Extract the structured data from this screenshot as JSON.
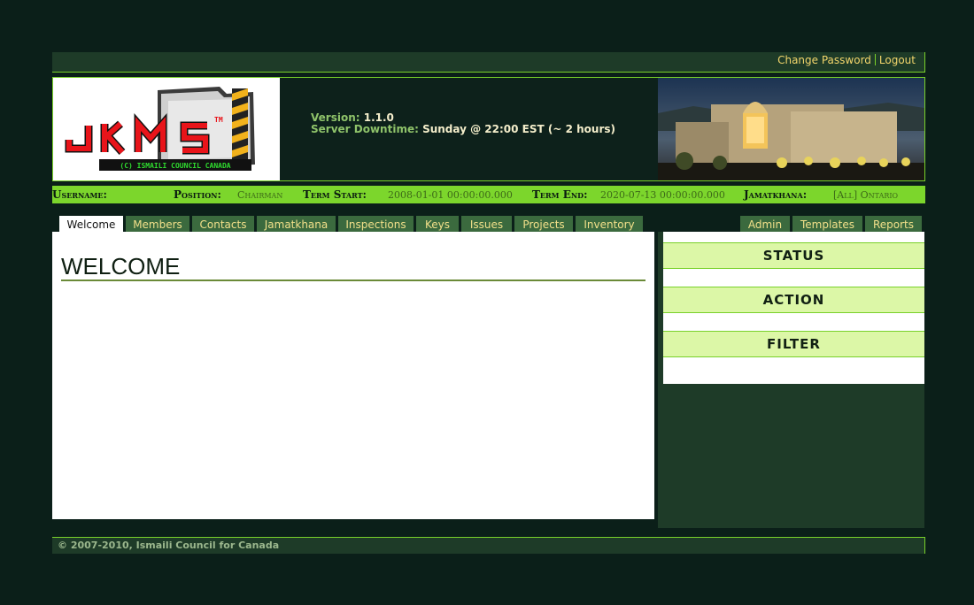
{
  "topbar": {
    "change_password": "Change Password",
    "logout": "Logout"
  },
  "banner": {
    "logo_text": "JKMS",
    "logo_tm": "TM",
    "logo_subtitle": "(C) ISMAILI COUNCIL CANADA",
    "version_label": "Version:",
    "version_value": "1.1.0",
    "downtime_label": "Server Downtime:",
    "downtime_value": "Sunday @ 22:00 EST (~ 2 hours)"
  },
  "userbar": {
    "username_label": "Username:",
    "username_value": "",
    "position_label": "Position:",
    "position_value": "Chairman",
    "term_start_label": "Term Start:",
    "term_start_value": "2008-01-01 00:00:00.000",
    "term_end_label": "Term End:",
    "term_end_value": "2020-07-13 00:00:00.000",
    "jamatkhana_label": "Jamatkhana:",
    "jamatkhana_value": "[All] Ontario"
  },
  "tabs_left": [
    "Welcome",
    "Members",
    "Contacts",
    "Jamatkhana",
    "Inspections",
    "Keys",
    "Issues",
    "Projects",
    "Inventory"
  ],
  "tabs_right": [
    "Admin",
    "Templates",
    "Reports"
  ],
  "active_tab": "Welcome",
  "main": {
    "title": "WELCOME"
  },
  "sidebar": {
    "status": "STATUS",
    "action": "ACTION",
    "filter": "FILTER"
  },
  "footer": {
    "copyright": "© 2007-2010, Ismaili Council for Canada"
  },
  "colors": {
    "accent": "#79d12a",
    "dark_bg": "#0b1f19",
    "panel": "#1e3b28",
    "tab": "#3b6a3e",
    "link": "#f2d56b"
  }
}
